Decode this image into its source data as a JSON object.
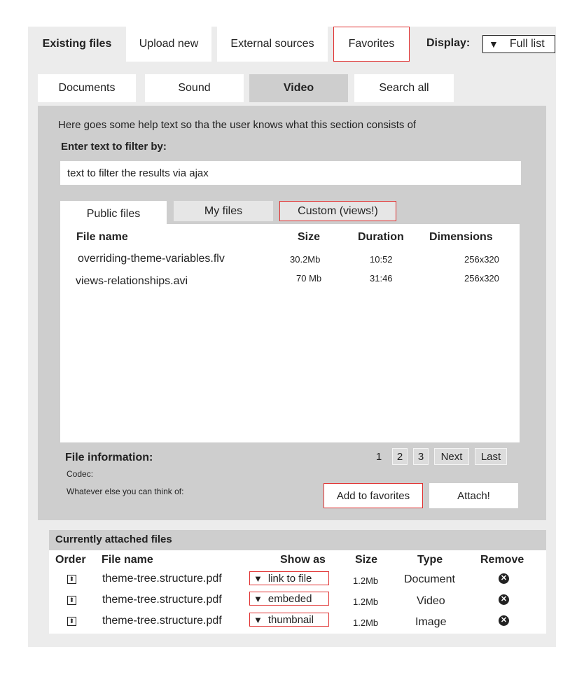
{
  "top_tabs": {
    "existing": "Existing files",
    "upload": "Upload new",
    "external": "External sources",
    "favorites": "Favorites"
  },
  "display": {
    "label": "Display:",
    "value": "Full list"
  },
  "media_tabs": [
    "Documents",
    "Sound",
    "Video",
    "Search all"
  ],
  "help_text": "Here goes some help text so tha the user knows what this section consists of",
  "filter": {
    "label": "Enter text to filter by:",
    "placeholder": "text to filter the results via ajax"
  },
  "sub_tabs": [
    "Public files",
    "My files",
    "Custom (views!)"
  ],
  "file_table": {
    "headers": [
      "File name",
      "Size",
      "Duration",
      "Dimensions"
    ],
    "rows": [
      [
        "overriding-theme-variables.flv",
        "30.2Mb",
        "10:52",
        "256x320"
      ],
      [
        "views-relationships.avi",
        "70 Mb",
        "31:46",
        "256x320"
      ]
    ]
  },
  "file_info": {
    "title": "File information:",
    "codec": "Codec:",
    "other": "Whatever else you can think of:"
  },
  "pagination": [
    "1",
    "2",
    "3",
    "Next",
    "Last"
  ],
  "buttons": {
    "favorites": "Add to favorites",
    "attach": "Attach!"
  },
  "attached": {
    "title": "Currently attached files",
    "headers": [
      "Order",
      "File name",
      "Show as",
      "Size",
      "Type",
      "Remove"
    ],
    "rows": [
      {
        "name": "theme-tree.structure.pdf",
        "show_as": "link to file",
        "size": "1.2Mb",
        "type": "Document"
      },
      {
        "name": "theme-tree.structure.pdf",
        "show_as": "embeded",
        "size": "1.2Mb",
        "type": "Video"
      },
      {
        "name": "theme-tree.structure.pdf",
        "show_as": "thumbnail",
        "size": "1.2Mb",
        "type": "Image"
      }
    ]
  },
  "colors": {
    "highlight_red": "#e03030",
    "panel_grey": "#cecece",
    "outer_grey": "#ececec"
  },
  "icons": [
    "dropdown-arrow-icon",
    "reorder-handle-icon",
    "remove-circle-icon"
  ]
}
